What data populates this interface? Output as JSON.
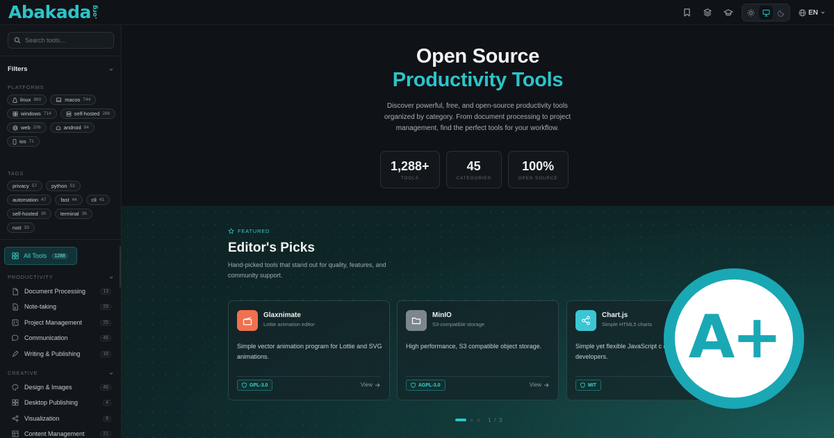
{
  "logo": {
    "name": "Abakada",
    "tld": ".org"
  },
  "header": {
    "lang": "EN"
  },
  "sidebar": {
    "search_placeholder": "Search tools...",
    "filters_title": "Filters",
    "platforms_label": "PLATFORMS",
    "platforms": [
      {
        "name": "linux",
        "count": "880"
      },
      {
        "name": "macos",
        "count": "744"
      },
      {
        "name": "windows",
        "count": "714"
      },
      {
        "name": "self-hosted",
        "count": "286"
      },
      {
        "name": "web",
        "count": "206"
      },
      {
        "name": "android",
        "count": "84"
      },
      {
        "name": "ios",
        "count": "71"
      }
    ],
    "tags_label": "TAGS",
    "tags": [
      {
        "name": "privacy",
        "count": "57"
      },
      {
        "name": "python",
        "count": "53"
      },
      {
        "name": "automation",
        "count": "47"
      },
      {
        "name": "fast",
        "count": "44"
      },
      {
        "name": "cli",
        "count": "41"
      },
      {
        "name": "self-hosted",
        "count": "39"
      },
      {
        "name": "terminal",
        "count": "36"
      },
      {
        "name": "rust",
        "count": "33"
      }
    ],
    "all_tools": {
      "label": "All Tools",
      "count": "1288"
    },
    "productivity_label": "PRODUCTIVITY",
    "productivity": [
      {
        "name": "Document Processing",
        "count": "13"
      },
      {
        "name": "Note-taking",
        "count": "29"
      },
      {
        "name": "Project Management",
        "count": "25"
      },
      {
        "name": "Communication",
        "count": "46"
      },
      {
        "name": "Writing & Publishing",
        "count": "18"
      }
    ],
    "creative_label": "CREATIVE",
    "creative": [
      {
        "name": "Design & Images",
        "count": "46"
      },
      {
        "name": "Desktop Publishing",
        "count": "4"
      },
      {
        "name": "Visualization",
        "count": "8"
      },
      {
        "name": "Content Management",
        "count": "21"
      }
    ]
  },
  "hero": {
    "title1": "Open Source",
    "title2": "Productivity Tools",
    "description": "Discover powerful, free, and open-source productivity tools organized by category. From document processing to project management, find the perfect tools for your workflow.",
    "stats": [
      {
        "value": "1,288+",
        "label": "TOOLS"
      },
      {
        "value": "45",
        "label": "CATEGORIES"
      },
      {
        "value": "100%",
        "label": "OPEN SOURCE"
      }
    ]
  },
  "featured": {
    "tag": "FEATURED",
    "title": "Editor's Picks",
    "description": "Hand-picked tools that stand out for quality, features, and community support.",
    "view_label": "View",
    "cards": [
      {
        "name": "Glaxnimate",
        "subtitle": "Lottie animation editor",
        "description": "Simple vector animation program for Lottie and SVG animations.",
        "license": "GPL-3.0",
        "color": "#f0714f"
      },
      {
        "name": "MinIO",
        "subtitle": "S3-compatible storage",
        "description": "High performance, S3 compatible object storage.",
        "license": "AGPL-3.0",
        "color": "#7e868d"
      },
      {
        "name": "Chart.js",
        "subtitle": "Simple HTML5 charts",
        "description": "Simple yet flexible JavaScript c designers and developers.",
        "license": "MIT",
        "color": "#3cc6d3"
      }
    ],
    "pager": "1 / 3"
  },
  "badge": {
    "text": "A+",
    "color": "#1aa8b5"
  }
}
